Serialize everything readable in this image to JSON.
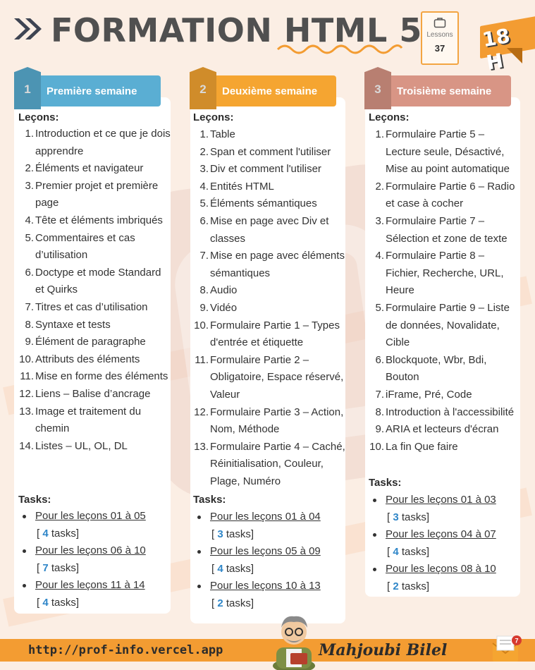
{
  "header": {
    "title": "FORMATION HTML 5",
    "lessons_label": "Lessons",
    "lessons_count": "37",
    "duration": "18 H"
  },
  "columns": [
    {
      "number": "1",
      "title": "Première semaine",
      "color": "#5aaed3",
      "lessons_heading": "Leçons:",
      "lessons": [
        "Introduction et ce que je dois apprendre",
        "Éléments et navigateur",
        "Premier projet et première page",
        "Tête et éléments imbriqués",
        "Commentaires et cas d’utilisation",
        "Doctype et mode Standard et Quirks",
        "Titres et cas d’utilisation",
        "Syntaxe et tests",
        "Élément de paragraphe",
        "Attributs des éléments",
        "Mise en forme des éléments",
        "Liens – Balise d’ancrage",
        "Image et traitement du chemin",
        "Listes – UL, OL, DL"
      ],
      "tasks_heading": "Tasks:",
      "tasks": [
        {
          "link": "Pour les leçons 01 à 05",
          "open": "[ ",
          "count": "4",
          "suffix": " tasks]"
        },
        {
          "link": "Pour les leçons 06 à 10",
          "open": "[ ",
          "count": "7",
          "suffix": " tasks]"
        },
        {
          "link": "Pour les leçons 11 à 14",
          "open": "[ ",
          "count": "4",
          "suffix": " tasks]"
        }
      ]
    },
    {
      "number": "2",
      "title": "Deuxième semaine",
      "color": "#f5a531",
      "lessons_heading": "Leçons:",
      "lessons": [
        "Table",
        "Span et comment l'utiliser",
        "Div et comment l'utiliser",
        "Entités HTML",
        "Éléments sémantiques",
        "Mise en page avec Div et classes",
        "Mise en page avec éléments sémantiques",
        "Audio",
        "Vidéo",
        "Formulaire Partie 1 – Types d'entrée et étiquette",
        "Formulaire Partie 2 – Obligatoire, Espace réservé, Valeur",
        "Formulaire Partie 3 – Action, Nom, Méthode",
        "Formulaire Partie 4 – Caché, Réinitialisation, Couleur, Plage, Numéro"
      ],
      "tasks_heading": "Tasks:",
      "tasks": [
        {
          "link": "Pour les leçons 01 à 04",
          "open": "[ ",
          "count": "3",
          "suffix": " tasks]"
        },
        {
          "link": "Pour les leçons 05 à 09",
          "open": "[ ",
          "count": "4",
          "suffix": " tasks]"
        },
        {
          "link": "Pour les leçons 10 à 13",
          "open": "[ ",
          "count": "2",
          "suffix": " tasks]"
        }
      ]
    },
    {
      "number": "3",
      "title": "Troisième semaine",
      "color": "#d89585",
      "lessons_heading": "Leçons:",
      "lessons": [
        "Formulaire Partie 5 – Lecture seule, Désactivé, Mise au point automatique",
        "Formulaire Partie 6 – Radio et case à cocher",
        "Formulaire Partie 7 – Sélection et zone de texte",
        "Formulaire Partie 8 – Fichier, Recherche, URL, Heure",
        "Formulaire Partie 9 – Liste de données, Novalidate, Cible",
        "Blockquote, Wbr, Bdi, Bouton",
        "iFrame, Pré, Code",
        "Introduction à l'accessibilité",
        "ARIA et lecteurs d'écran",
        "La fin Que faire"
      ],
      "tasks_heading": "Tasks:",
      "tasks": [
        {
          "link": "Pour les leçons 01 à 03",
          "open": "[ ",
          "count": "3",
          "suffix": " tasks]"
        },
        {
          "link": "Pour les leçons 04 à 07",
          "open": "[ ",
          "count": "4",
          "suffix": " tasks]"
        },
        {
          "link": "Pour les leçons 08 à 10",
          "open": "[ ",
          "count": "2",
          "suffix": " tasks]"
        }
      ]
    }
  ],
  "footer": {
    "url": "http://prof-info.vercel.app",
    "author": "Mahjoubi Bilel",
    "notification_count": "7"
  },
  "icons": [
    "double-chevron-icon",
    "briefcase-icon",
    "teacher-avatar-icon",
    "mail-icon"
  ]
}
